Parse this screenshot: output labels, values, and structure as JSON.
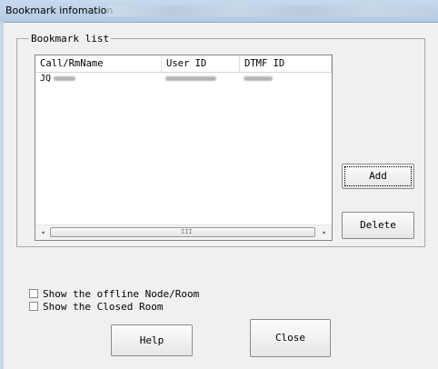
{
  "window": {
    "title": "Bookmark infomation"
  },
  "group": {
    "legend": "Bookmark list"
  },
  "table": {
    "columns": [
      "Call/RmName",
      "User ID",
      "DTMF ID"
    ],
    "rows": [
      {
        "call": "JQ"
      }
    ]
  },
  "scrollbar": {
    "left_arrow": "◂",
    "right_arrow": "▸",
    "grip": "III"
  },
  "buttons": {
    "add": "Add",
    "delete": "Delete",
    "help": "Help",
    "close": "Close"
  },
  "options": {
    "show_offline": {
      "label": "Show the offline Node/Room",
      "checked": false
    },
    "show_closed": {
      "label": "Show the Closed Room",
      "checked": false
    }
  }
}
